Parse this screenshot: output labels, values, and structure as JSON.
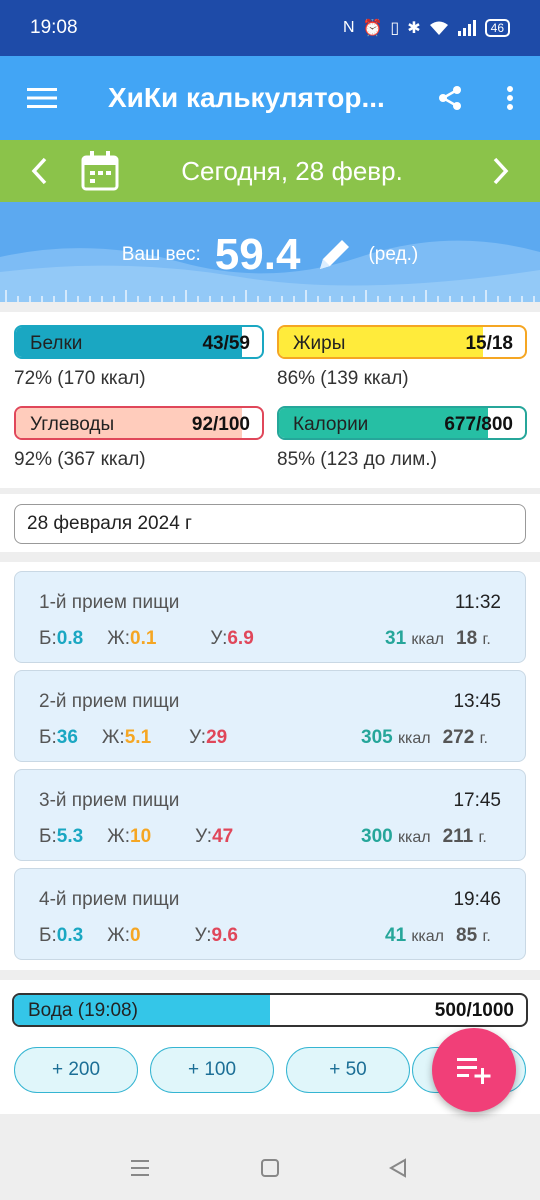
{
  "status": {
    "time": "19:08",
    "battery": "46",
    "icons": [
      "nfc-icon",
      "alarm-icon",
      "vibrate-icon",
      "bluetooth-icon",
      "wifi-icon",
      "signal-icon",
      "battery-icon"
    ]
  },
  "appbar": {
    "title": "ХиКи калькулятор...",
    "icons": [
      "menu-icon",
      "share-icon",
      "more-icon"
    ]
  },
  "datebar": {
    "date": "Сегодня, 28 февр."
  },
  "weight": {
    "label": "Ваш вес:",
    "value": "59.4",
    "edit": "(ред.)"
  },
  "macros": [
    {
      "name": "Белки",
      "amount": "43/59",
      "fill_fraction": 0.92,
      "color": "#1aa7c2",
      "border": "#1aa7c2",
      "note": "72% (170 ккал)"
    },
    {
      "name": "Жиры",
      "amount": "15/18",
      "fill_fraction": 0.83,
      "color": "#ffeb3b",
      "border": "#f5a623",
      "note": "86% (139 ккал)"
    },
    {
      "name": "Углеводы",
      "amount": "92/100",
      "fill_fraction": 0.92,
      "color": "#ffccbc",
      "border": "#e0475a",
      "note": "92% (367 ккал)"
    },
    {
      "name": "Калории",
      "amount": "677/800",
      "fill_fraction": 0.85,
      "color": "#26bfa4",
      "border": "#26a69a",
      "note": "85% (123 до лим.)"
    }
  ],
  "date_field": "28 февраля 2024 г",
  "meals": [
    {
      "name": "1-й прием пищи",
      "time": "11:32",
      "p_label": "Б:",
      "p": "0.8",
      "f_label": "Ж:",
      "f": "0.1",
      "c_label": "У:",
      "c": "6.9",
      "kcal": "31",
      "kcal_unit": "ккал",
      "grams": "18",
      "grams_unit": "г."
    },
    {
      "name": "2-й прием пищи",
      "time": "13:45",
      "p_label": "Б:",
      "p": "36",
      "f_label": "Ж:",
      "f": "5.1",
      "c_label": "У:",
      "c": "29",
      "kcal": "305",
      "kcal_unit": "ккал",
      "grams": "272",
      "grams_unit": "г."
    },
    {
      "name": "3-й прием пищи",
      "time": "17:45",
      "p_label": "Б:",
      "p": "5.3",
      "f_label": "Ж:",
      "f": "10",
      "c_label": "У:",
      "c": "47",
      "kcal": "300",
      "kcal_unit": "ккал",
      "grams": "211",
      "grams_unit": "г."
    },
    {
      "name": "4-й прием пищи",
      "time": "19:46",
      "p_label": "Б:",
      "p": "0.3",
      "f_label": "Ж:",
      "f": "0",
      "c_label": "У:",
      "c": "9.6",
      "kcal": "41",
      "kcal_unit": "ккал",
      "grams": "85",
      "grams_unit": "г."
    }
  ],
  "water": {
    "label": "Вода (19:08)",
    "amount": "500/1000",
    "fill_fraction": 0.5,
    "buttons": [
      "+ 200",
      "+ 100",
      "+ 50"
    ]
  }
}
